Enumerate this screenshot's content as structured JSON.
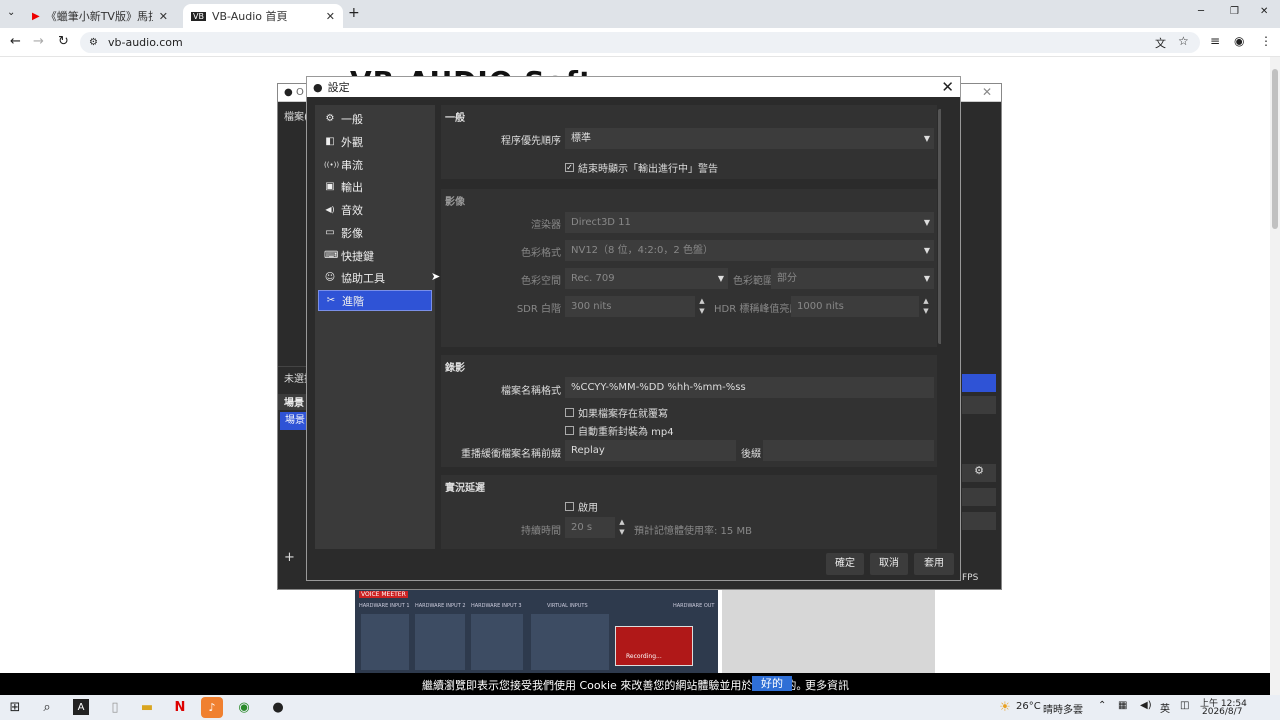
{
  "browser": {
    "tabs": [
      {
        "label": "《蠟筆小新TV版》馬拉松至"
      },
      {
        "label": "VB-Audio 首頁"
      }
    ],
    "url": "vb-audio.com",
    "new_tab": "+",
    "window_controls": {
      "min": "─",
      "max": "❐",
      "close": "✕"
    }
  },
  "website": {
    "logo_partial": "VB-AUDIO Soft"
  },
  "obs_main": {
    "title": "O",
    "menu_file": "檔案(",
    "not_selected": "未選擇",
    "scenes_header": "場景",
    "scene_item": "場景",
    "fps": "FPS"
  },
  "settings": {
    "title": "設定",
    "nav": [
      {
        "label": "一般",
        "icon": "⚙"
      },
      {
        "label": "外觀",
        "icon": "◧"
      },
      {
        "label": "串流",
        "icon": "((•))"
      },
      {
        "label": "輸出",
        "icon": "▣"
      },
      {
        "label": "音效",
        "icon": "◀)"
      },
      {
        "label": "影像",
        "icon": "▭"
      },
      {
        "label": "快捷鍵",
        "icon": "⌨"
      },
      {
        "label": "協助工具",
        "icon": "☺"
      },
      {
        "label": "進階",
        "icon": "✂"
      }
    ],
    "general": {
      "header": "一般",
      "priority_label": "程序優先順序",
      "priority_value": "標準",
      "warn_on_close": "結束時顯示「輸出進行中」警告"
    },
    "video": {
      "header": "影像",
      "renderer_label": "渲染器",
      "renderer_value": "Direct3D 11",
      "color_format_label": "色彩格式",
      "color_format_value": "NV12（8 位，4:2:0，2 色盤）",
      "color_space_label": "色彩空間",
      "color_space_value": "Rec. 709",
      "color_range_label": "色彩範圍",
      "color_range_value": "部分",
      "sdr_label": "SDR 白階",
      "sdr_value": "300 nits",
      "hdr_label": "HDR 標稱峰值亮度",
      "hdr_value": "1000 nits"
    },
    "recording": {
      "header": "錄影",
      "filename_label": "檔案名稱格式",
      "filename_value": "%CCYY-%MM-%DD %hh-%mm-%ss",
      "overwrite": "如果檔案存在就覆寫",
      "remux": "自動重新封裝為 mp4",
      "replay_prefix_label": "重播緩衝檔案名稱前綴",
      "replay_prefix_value": "Replay",
      "suffix_label": "後綴",
      "suffix_value": ""
    },
    "delay": {
      "header": "實況延遲",
      "enable": "啟用",
      "duration_label": "持續時間",
      "duration_value": "20 s",
      "memory_usage": "預計記憶體使用率: 15 MB"
    },
    "buttons": {
      "ok": "確定",
      "cancel": "取消",
      "apply": "套用"
    }
  },
  "cookie_bar": {
    "text": "繼續瀏覽即表示您接受我們使用 Cookie 來改善您的網站體驗並用於分析目的。",
    "ok": "好的",
    "more": "更多資訊"
  },
  "voicemeeter": {
    "brand": "VOICE MEETER",
    "inputs": [
      "HARDWARE INPUT 1",
      "HARDWARE INPUT 2",
      "HARDWARE INPUT 3",
      "VIRTUAL INPUTS",
      "HARDWARE OUT"
    ],
    "recording": "Recording..."
  },
  "taskbar": {
    "weather_temp": "26°C",
    "weather_desc": "晴時多雲",
    "ime": "英",
    "time": "上午 12:54",
    "date": "2026/8/7"
  }
}
